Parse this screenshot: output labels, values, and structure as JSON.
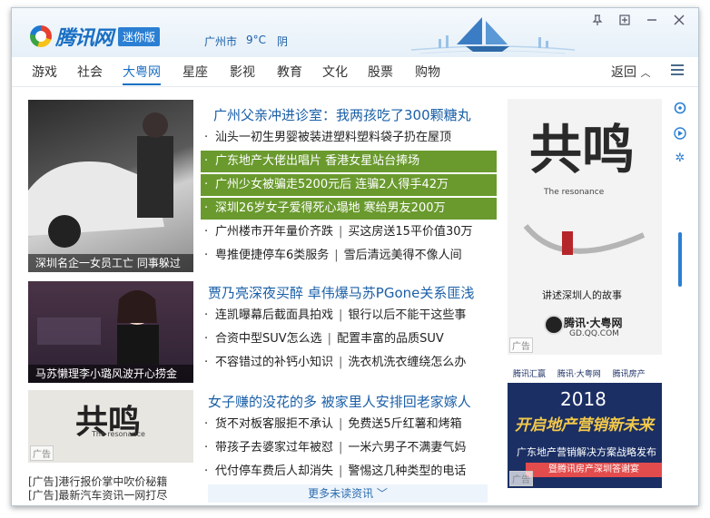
{
  "header": {
    "logo_text": "腾讯网",
    "badge": "迷你版",
    "city": "广州市",
    "temperature": "9°C",
    "weather": "阴"
  },
  "window_controls": [
    "pin-icon",
    "maximize-icon",
    "minimize-icon",
    "close-icon"
  ],
  "nav": {
    "items": [
      "游戏",
      "社会",
      "大粤网",
      "星座",
      "影视",
      "教育",
      "文化",
      "股票",
      "购物"
    ],
    "active": "大粤网",
    "back_label": "返回"
  },
  "photos": [
    {
      "caption": "深圳名企一女员工亡 同事躲过"
    },
    {
      "caption": "马苏懒理李小璐风波开心捞金"
    },
    {
      "caption": "",
      "ad_tag": "广告",
      "art_text": "共鸣",
      "art_sub": "The resonance"
    }
  ],
  "left_ads": [
    "[广告]港行报价掌中吹价秘籍",
    "[广告]最新汽车资讯一网打尽"
  ],
  "news": {
    "headline1": "广州父亲冲进诊室：我两孩吃了300颗糖丸",
    "group1": [
      {
        "text": "汕头一初生男婴被装进塑料塑料袋子扔在屋顶",
        "highlight": false
      },
      {
        "text": "广东地产大佬出唱片 香港女星站台捧场",
        "highlight": true
      },
      {
        "text": "广州少女被骗走5200元后 连骗2人得手42万",
        "highlight": true
      },
      {
        "text": "深圳26岁女子爱得死心塌地 寒给男友200万",
        "highlight": true
      },
      {
        "text": "广州楼市开年量价齐跌",
        "text2": "买这房送15平价值30万",
        "highlight": false
      },
      {
        "text": "粤推便捷停车6类服务",
        "text2": "雪后清远美得不像人间",
        "highlight": false
      }
    ],
    "headline2": "贾乃亮深夜买醉 卓伟爆马苏PGone关系匪浅",
    "group2": [
      {
        "text": "连凯曝幕后截面具拍戏",
        "text2": "银行以后不能干这些事"
      },
      {
        "text": "合资中型SUV怎么选",
        "text2": "配置丰富的品质SUV"
      },
      {
        "text": "不容错过的补钙小知识",
        "text2": "洗衣机洗衣缠绕怎么办"
      }
    ],
    "headline3": "女子赚的没花的多 被家里人安排回老家嫁人",
    "group3": [
      {
        "text": "货不对板客服拒不承认",
        "text2": "免费送5斤红薯和烤箱"
      },
      {
        "text": "带孩子去婆家过年被怼",
        "text2": "一米六男子不满妻气妈"
      },
      {
        "text": "代付停车费后人却消失",
        "text2": "警惕这几种类型的电话"
      }
    ],
    "more_label": "更多未读资讯"
  },
  "side_ad1": {
    "art_text": "共鸣",
    "sub": "The resonance",
    "caption": "讲述深圳人的故事",
    "brand": "腾讯·大粤网",
    "url": "GD.QQ.COM",
    "ad_tag": "广告"
  },
  "side_ad2": {
    "logos": [
      "腾讯汇赢",
      "腾讯·大粤网",
      "腾讯房产"
    ],
    "year": "2018",
    "title": "开启地产营销新未来",
    "subtitle": "广东地产营销解决方案战略发布",
    "banner": "暨腾讯房产深圳答谢宴",
    "ad_tag": "广告"
  },
  "side_icons": [
    "refresh-icon",
    "play-icon",
    "settings-icon"
  ]
}
